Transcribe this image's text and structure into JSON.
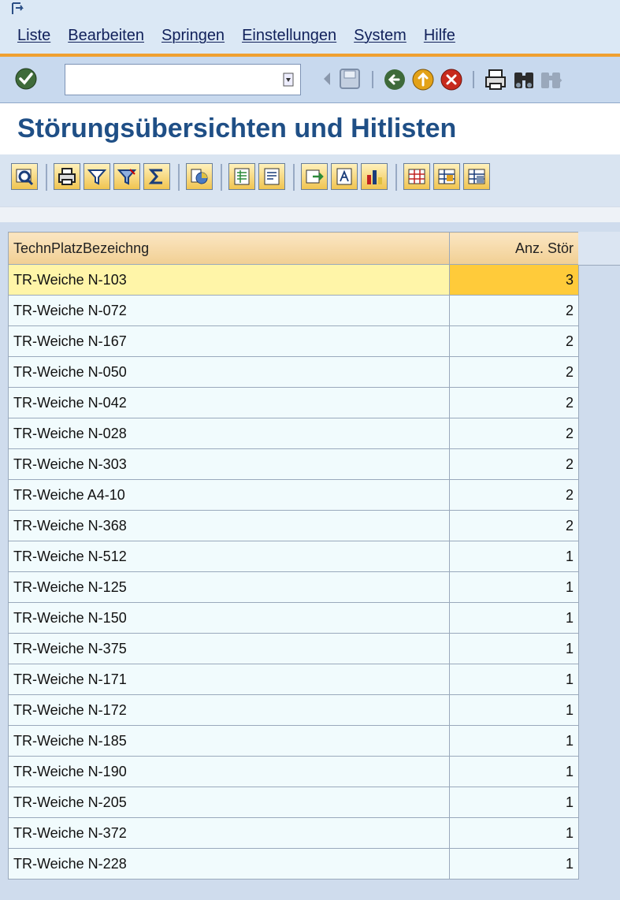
{
  "menu": {
    "items": [
      "Liste",
      "Bearbeiten",
      "Springen",
      "Einstellungen",
      "System",
      "Hilfe"
    ]
  },
  "toolbar": {
    "command_value": "",
    "icons": [
      "enter-icon",
      "back-icon",
      "save-icon",
      "back-arrow-icon",
      "exit-icon",
      "cancel-icon",
      "print-icon",
      "find-icon",
      "find-next-icon"
    ]
  },
  "page": {
    "title": "Störungsübersichten und Hitlisten"
  },
  "app_toolbar": {
    "icons": [
      "details-icon",
      "print-preview-icon",
      "filter-icon",
      "set-filter-icon",
      "sum-icon",
      "graphic-icon",
      "export-spreadsheet-icon",
      "word-processing-icon",
      "local-file-icon",
      "abc-analysis-icon",
      "chart-icon",
      "layout-icon",
      "select-layout-icon",
      "save-layout-icon"
    ]
  },
  "table": {
    "columns": [
      "TechnPlatzBezeichng",
      "Anz. Stör"
    ],
    "rows": [
      {
        "name": "TR-Weiche N-103",
        "count": "3"
      },
      {
        "name": "TR-Weiche N-072",
        "count": "2"
      },
      {
        "name": "TR-Weiche N-167",
        "count": "2"
      },
      {
        "name": "TR-Weiche N-050",
        "count": "2"
      },
      {
        "name": "TR-Weiche N-042",
        "count": "2"
      },
      {
        "name": "TR-Weiche N-028",
        "count": "2"
      },
      {
        "name": "TR-Weiche N-303",
        "count": "2"
      },
      {
        "name": "TR-Weiche A4-10",
        "count": "2"
      },
      {
        "name": "TR-Weiche N-368",
        "count": "2"
      },
      {
        "name": "TR-Weiche N-512",
        "count": "1"
      },
      {
        "name": "TR-Weiche N-125",
        "count": "1"
      },
      {
        "name": "TR-Weiche N-150",
        "count": "1"
      },
      {
        "name": "TR-Weiche N-375",
        "count": "1"
      },
      {
        "name": "TR-Weiche N-171",
        "count": "1"
      },
      {
        "name": "TR-Weiche N-172",
        "count": "1"
      },
      {
        "name": "TR-Weiche N-185",
        "count": "1"
      },
      {
        "name": "TR-Weiche N-190",
        "count": "1"
      },
      {
        "name": "TR-Weiche N-205",
        "count": "1"
      },
      {
        "name": "TR-Weiche N-372",
        "count": "1"
      },
      {
        "name": "TR-Weiche N-228",
        "count": "1"
      }
    ]
  },
  "colors": {
    "title": "#1f4f86",
    "menu_accent": "#f0a030",
    "selected_row": "#fff5a8",
    "selected_count": "#ffcb3a"
  }
}
